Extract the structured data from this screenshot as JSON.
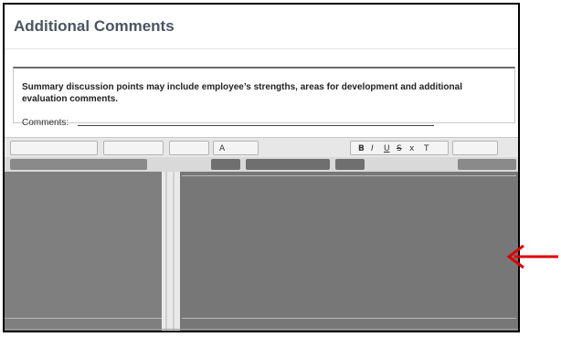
{
  "panel": {
    "title": "Additional Comments"
  },
  "summary": {
    "text": "Summary discussion points may include employee’s strengths, areas for development and additional evaluation comments.",
    "comments_label": "Comments:"
  },
  "toolbar": {
    "glyphs": [
      "A",
      "B",
      "I",
      "U",
      "S",
      "x",
      "T"
    ]
  },
  "annotation": {
    "arrow_color": "#e00000"
  },
  "colors": {
    "editor_bg": "#7a7a7a",
    "title_color": "#4a5563"
  }
}
